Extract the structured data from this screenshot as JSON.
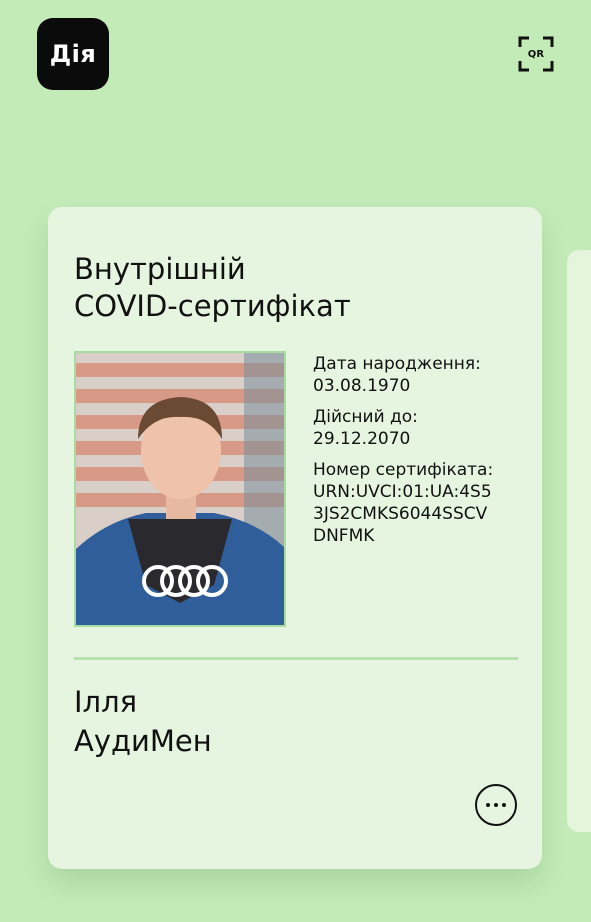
{
  "app": {
    "logo_text": "Дія",
    "qr_label": "QR"
  },
  "certificate": {
    "title_line1": "Внутрішній",
    "title_line2": "COVID-сертифікат",
    "birth_date_label": "Дата народження:",
    "birth_date": "03.08.1970",
    "valid_until_label": "Дійсний до:",
    "valid_until": "29.12.2070",
    "cert_number_label": "Номер сертифіката:",
    "cert_number_lines": [
      "URN:UVCI:01:UA:4S5",
      "3JS2CMKS6044SSCV",
      "DNFMK"
    ],
    "first_name": "Ілля",
    "last_name": "АудиМен"
  },
  "colors": {
    "background": "#c3ebb8",
    "card": "#e6f5e0",
    "divider": "#b9e3ae",
    "text": "#111111"
  },
  "icons": {
    "qr": "qr-scan-icon",
    "more": "more-horizontal-icon"
  }
}
